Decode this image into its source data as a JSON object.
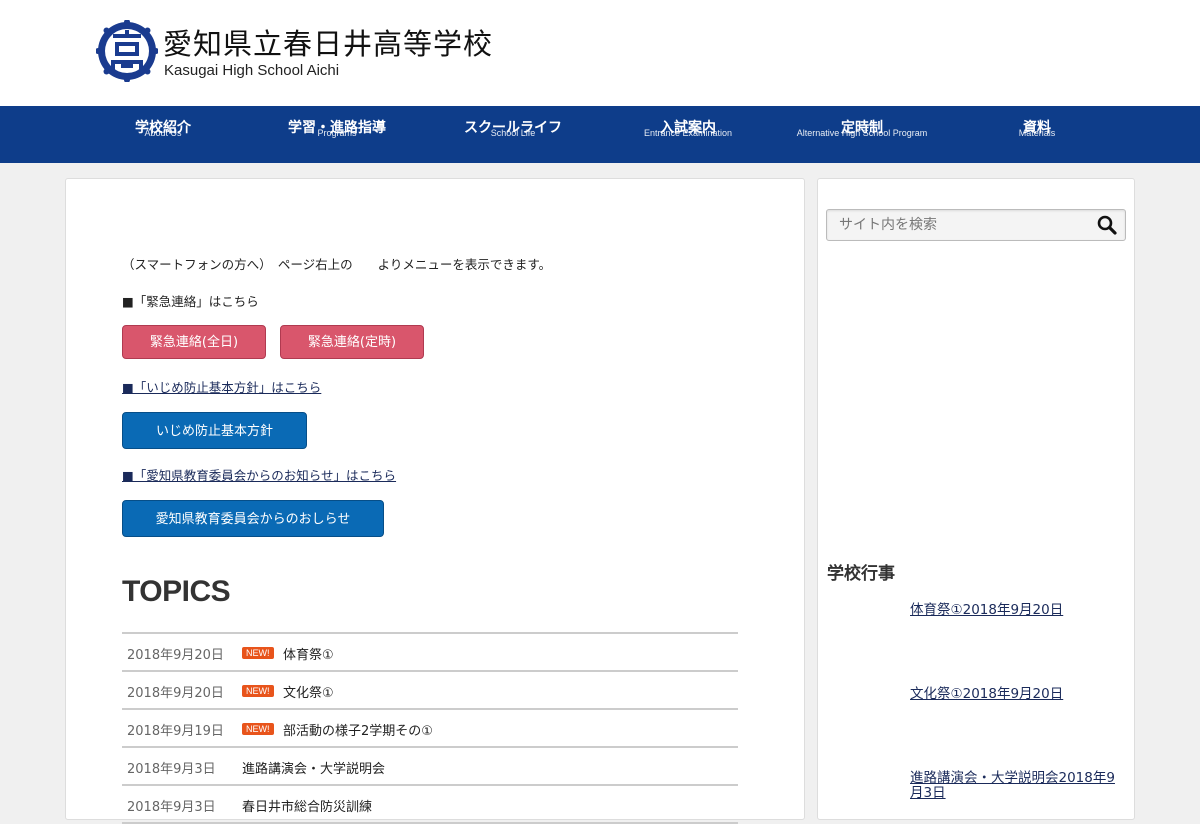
{
  "header": {
    "school_name": "愛知県立春日井高等学校",
    "school_name_en": "Kasugai High School Aichi"
  },
  "nav": [
    {
      "label": "学校紹介",
      "sub": "About Us"
    },
    {
      "label": "学習・進路指導",
      "sub": "Programs"
    },
    {
      "label": "スクールライフ",
      "sub": "School Life"
    },
    {
      "label": "入試案内",
      "sub": "Entrance Examination"
    },
    {
      "label": "定時制",
      "sub": "Alternative High School Program"
    },
    {
      "label": "資料",
      "sub": "Materials"
    }
  ],
  "main": {
    "smartphone_note": "（スマートフォンの方へ）　ページ右上の　　よりメニューを表示できます。",
    "emergency_heading": "■「緊急連絡」はこちら",
    "emergency_full_label": "緊急連絡(全日)",
    "emergency_part_label": "緊急連絡(定時)",
    "bullying_heading": "■「いじめ防止基本方針」はこちら",
    "bullying_button_label": "いじめ防止基本方針",
    "board_heading": "■「愛知県教育委員会からのお知らせ」はこちら",
    "board_button_label": "愛知県教育委員会からのおしらせ",
    "topics_title": "TOPICS",
    "new_badge": "NEW!",
    "topics": [
      {
        "date": "2018年9月20日",
        "title": "体育祭①",
        "new": true
      },
      {
        "date": "2018年9月20日",
        "title": "文化祭①",
        "new": true
      },
      {
        "date": "2018年9月19日",
        "title": "部活動の様子2学期その①",
        "new": true
      },
      {
        "date": "2018年9月3日",
        "title": "進路講演会・大学説明会",
        "new": false
      },
      {
        "date": "2018年9月3日",
        "title": "春日井市総合防災訓練",
        "new": false
      }
    ]
  },
  "sidebar": {
    "search_placeholder": "サイト内を検索",
    "events_heading": "学校行事",
    "events": [
      {
        "label": "体育祭①2018年9月20日"
      },
      {
        "label": "文化祭①2018年9月20日"
      },
      {
        "label": "進路講演会・大学説明会2018年9月3日"
      }
    ]
  },
  "colors": {
    "nav_bg": "#0e3d8a",
    "emergency_button": "#d9566c",
    "info_button": "#0a6ab5",
    "new_badge": "#e8541b"
  }
}
